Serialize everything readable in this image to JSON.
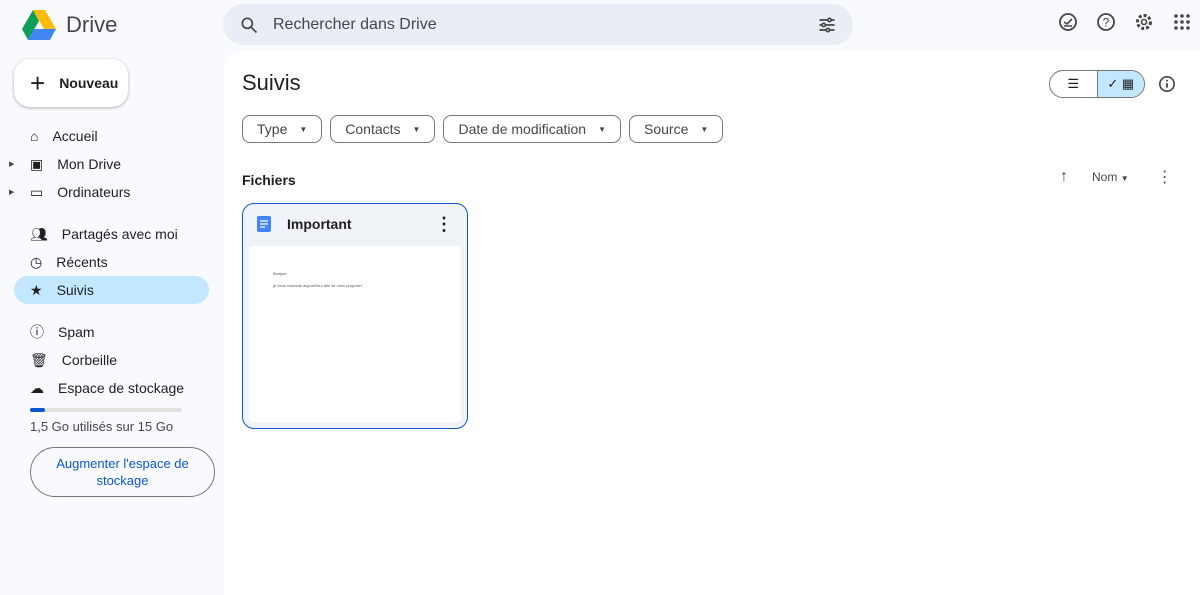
{
  "app": {
    "name": "Drive"
  },
  "search": {
    "placeholder": "Rechercher dans Drive"
  },
  "new_button": "Nouveau",
  "sidebar": {
    "items": [
      {
        "label": "Accueil",
        "icon": "home-icon"
      },
      {
        "label": "Mon Drive",
        "icon": "my-drive-icon"
      },
      {
        "label": "Ordinateurs",
        "icon": "computers-icon"
      },
      {
        "label": "Partagés avec moi",
        "icon": "shared-icon"
      },
      {
        "label": "Récents",
        "icon": "clock-icon"
      },
      {
        "label": "Suivis",
        "icon": "star-icon",
        "active": true
      },
      {
        "label": "Spam",
        "icon": "spam-icon"
      },
      {
        "label": "Corbeille",
        "icon": "trash-icon"
      },
      {
        "label": "Espace de stockage",
        "icon": "cloud-icon"
      }
    ]
  },
  "storage": {
    "text": "1,5 Go utilisés sur 15 Go",
    "used_fraction": 0.1,
    "upgrade": "Augmenter l'espace de stockage"
  },
  "main": {
    "title": "Suivis",
    "filters": [
      "Type",
      "Contacts",
      "Date de modification",
      "Source"
    ],
    "section": "Fichiers",
    "sort": "Nom"
  },
  "files": [
    {
      "name": "Important",
      "preview_lines": [
        "Bonjour",
        "je vous contacte aujourd'hui afin de vous proposer"
      ]
    }
  ],
  "colors": {
    "accent": "#0b57d0",
    "active": "#c2e7ff"
  }
}
